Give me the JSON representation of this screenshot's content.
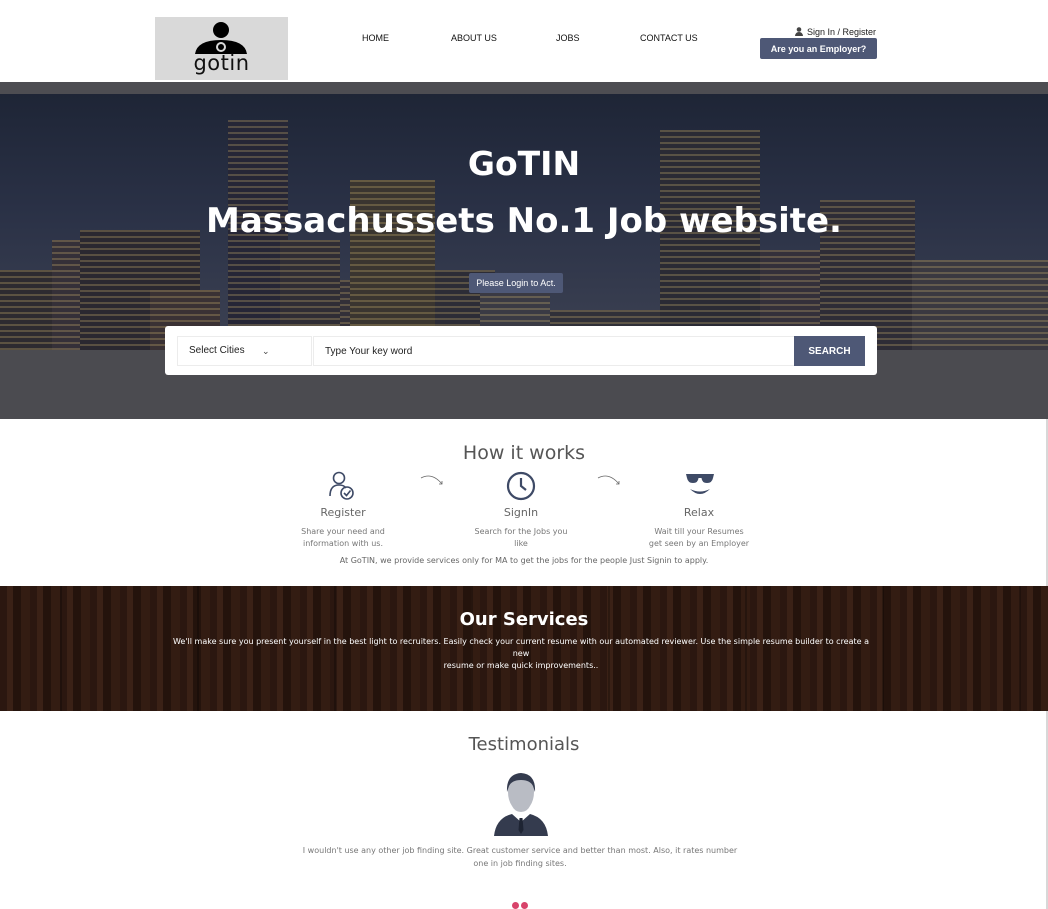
{
  "header": {
    "logo_text": "gotin",
    "nav": [
      {
        "label": "HOME"
      },
      {
        "label": "ABOUT US"
      },
      {
        "label": "JOBS"
      },
      {
        "label": "CONTACT US"
      }
    ],
    "sign_in_label": "Sign In / Register",
    "employer_button": "Are you an Employer?"
  },
  "hero": {
    "title": "GoTIN",
    "subtitle": "Massachussets No.1 Job website.",
    "login_button": "Please Login to Act."
  },
  "search": {
    "city_select": "Select Cities",
    "keyword_placeholder": "Type Your key word",
    "button_label": "SEARCH"
  },
  "how_it_works": {
    "heading": "How it works",
    "steps": [
      {
        "title": "Register",
        "desc_line1": "Share your need and",
        "desc_line2": "information with us.",
        "icon": "user-check-icon"
      },
      {
        "title": "SignIn",
        "desc_line1": "Search for the Jobs you",
        "desc_line2": "like",
        "icon": "clock-icon"
      },
      {
        "title": "Relax",
        "desc_line1": "Wait till your Resumes",
        "desc_line2": "get seen by an Employer",
        "icon": "sunglasses-smiley-icon"
      }
    ],
    "note": "At GoTIN, we provide services only for MA to get the jobs for the people Just Signin to apply."
  },
  "services": {
    "heading": "Our Services",
    "text_line1": "We'll make sure you present yourself in the best light to recruiters. Easily check your current resume with our automated reviewer. Use the simple resume builder to create a new",
    "text_line2": "resume or make quick improvements.."
  },
  "testimonials": {
    "heading": "Testimonials",
    "quote_line1": "I wouldn't use any other job finding site. Great customer service and better than most. Also, it rates number",
    "quote_line2": "one in job finding sites."
  },
  "colors": {
    "accent": "#4e5876",
    "dot": "#d8436a",
    "wood": "#2e1a11"
  }
}
